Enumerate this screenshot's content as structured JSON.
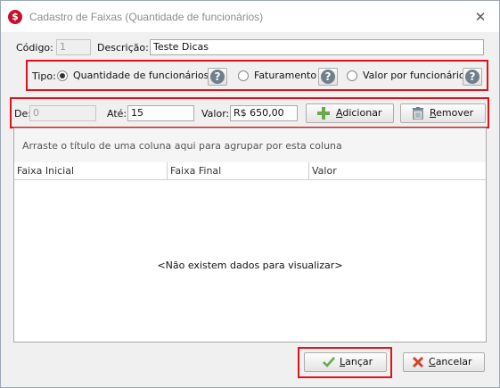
{
  "window": {
    "title": "Cadastro de Faixas (Quantidade de funcionários)",
    "app_icon": "$",
    "close_glyph": "✕"
  },
  "form": {
    "codigo_label": "Código:",
    "codigo_value": "1",
    "descricao_label": "Descrição:",
    "descricao_value": "Teste Dicas"
  },
  "tipo": {
    "label": "Tipo:",
    "options": [
      {
        "label": "Quantidade de funcionários",
        "checked": true
      },
      {
        "label": "Faturamento",
        "checked": false
      },
      {
        "label": "Valor por funcionário",
        "checked": false
      }
    ],
    "help_glyph": "?"
  },
  "range": {
    "de_label": "De:",
    "de_value": "0",
    "ate_label": "Até:",
    "ate_value": "15",
    "valor_label": "Valor:",
    "valor_value": "R$ 650,00",
    "add_label_underlined": "A",
    "add_label_rest": "dicionar",
    "remove_label_underlined": "R",
    "remove_label_rest": "emover"
  },
  "grid": {
    "group_hint": "Arraste o título de uma coluna aqui para agrupar por esta coluna",
    "columns": [
      "Faixa Inicial",
      "Faixa Final",
      "Valor"
    ],
    "empty_message": "<Não existem dados para visualizar>"
  },
  "footer": {
    "lancar_underlined": "L",
    "lancar_rest": "ançar",
    "cancelar_underlined": "C",
    "cancelar_rest": "ancelar"
  },
  "colors": {
    "highlight": "#e0121a",
    "add_icon": "#6aa84f",
    "ok_icon": "#6aa84f",
    "cancel_icon": "#d0442b"
  }
}
